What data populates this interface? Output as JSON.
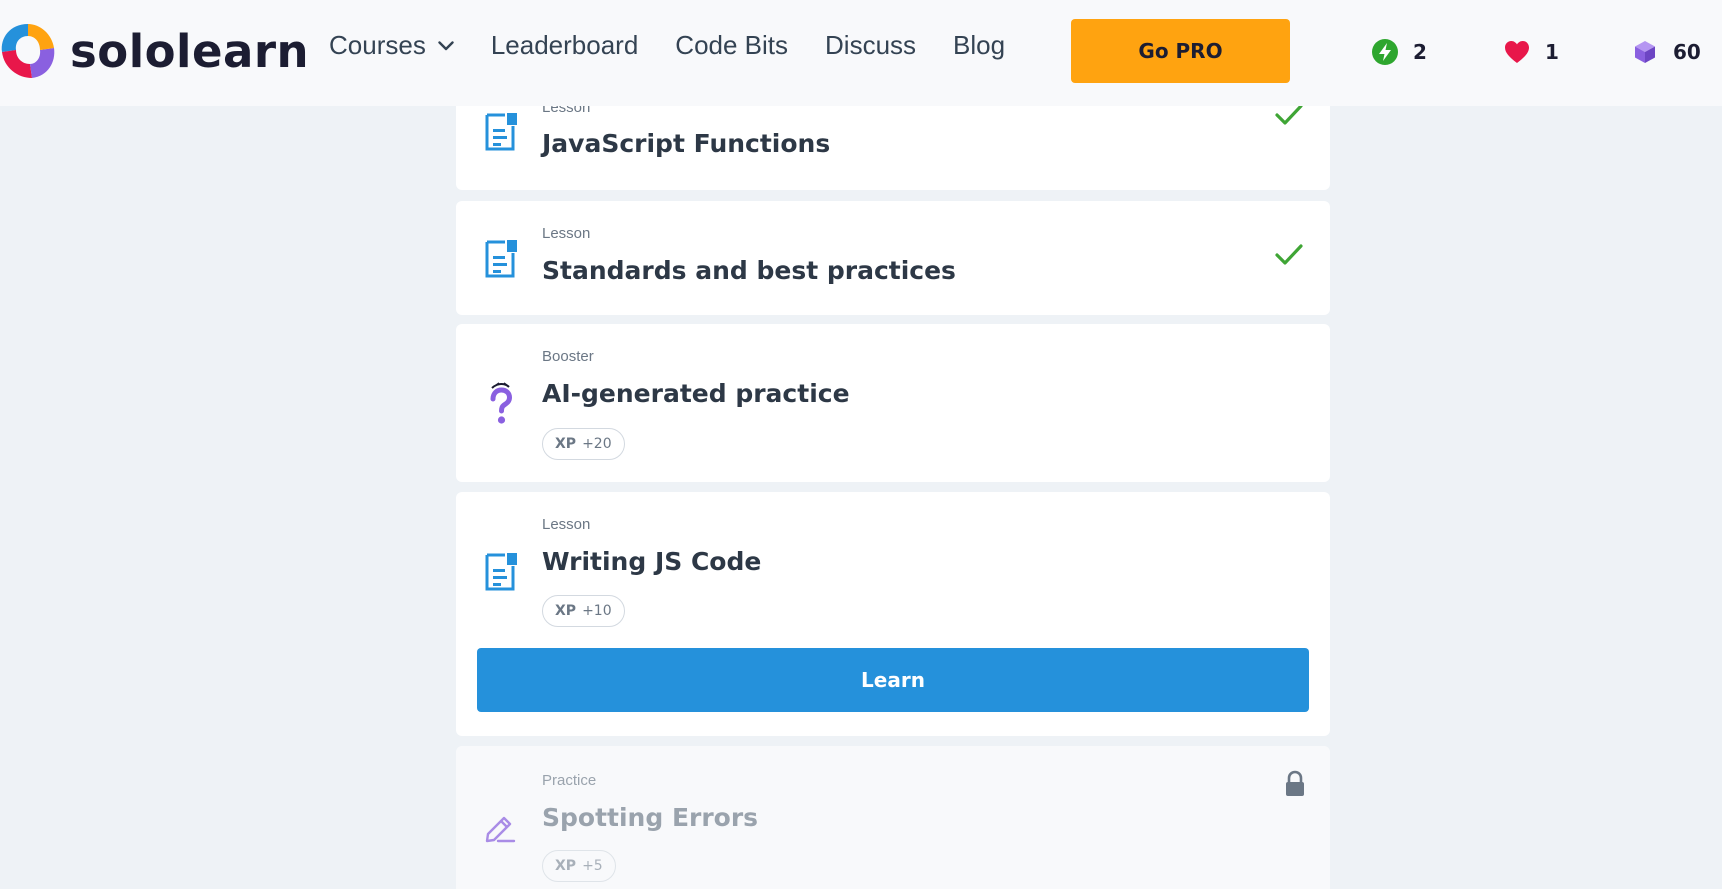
{
  "app": {
    "brand": "sololearn",
    "bg_color": "#eef2f6",
    "accent": "#2591db"
  },
  "header": {
    "nav": [
      {
        "label": "Courses",
        "has_dropdown": true
      },
      {
        "label": "Leaderboard"
      },
      {
        "label": "Code Bits"
      },
      {
        "label": "Discuss"
      },
      {
        "label": "Blog"
      }
    ],
    "go_pro_label": "Go PRO",
    "go_pro_color": "#ffa310",
    "stats": {
      "streak": {
        "value": "2",
        "icon": "lightning-icon",
        "color": "#2ea62e"
      },
      "hearts": {
        "value": "1",
        "icon": "heart-icon",
        "color": "#e8174a"
      },
      "gems": {
        "value": "60",
        "icon": "gem-icon",
        "color": "#8a60e0"
      }
    }
  },
  "lessons": [
    {
      "type": "Lesson",
      "title": "JavaScript Functions",
      "status": "completed",
      "icon": "document-icon"
    },
    {
      "type": "Lesson",
      "title": "Standards and best practices",
      "status": "completed",
      "icon": "document-icon"
    },
    {
      "type": "Booster",
      "title": "AI-generated practice",
      "status": "available",
      "icon": "question-icon",
      "xp_label": "XP",
      "xp_value": "+20"
    },
    {
      "type": "Lesson",
      "title": "Writing JS Code",
      "status": "current",
      "icon": "document-icon",
      "xp_label": "XP",
      "xp_value": "+10",
      "button_label": "Learn"
    },
    {
      "type": "Practice",
      "title": "Spotting Errors",
      "status": "locked",
      "icon": "pencil-icon",
      "xp_label": "XP",
      "xp_value": "+5"
    }
  ]
}
